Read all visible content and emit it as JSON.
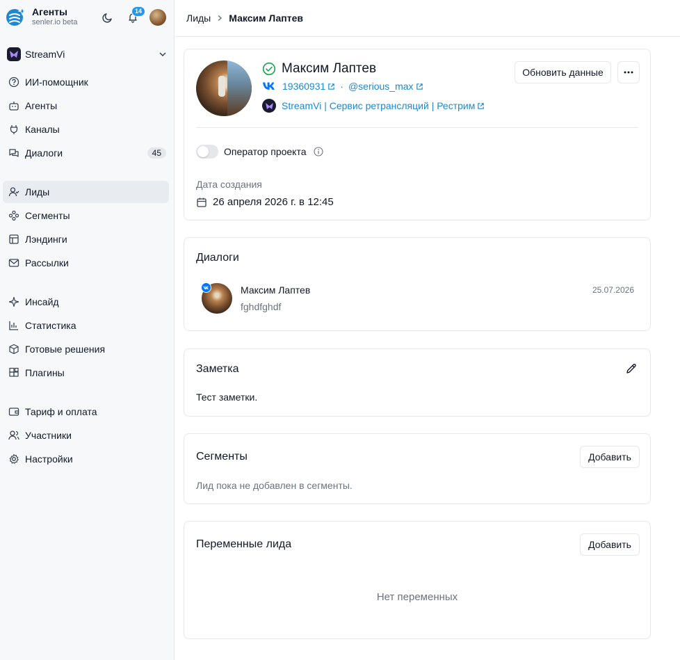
{
  "app": {
    "title": "Агенты",
    "subtitle": "senler.io beta",
    "notifications_count": "14"
  },
  "project": {
    "name": "StreamVi"
  },
  "sidebar": {
    "group1": [
      {
        "label": "ИИ-помощник",
        "icon": "help-circle-icon"
      },
      {
        "label": "Агенты",
        "icon": "bot-icon"
      },
      {
        "label": "Каналы",
        "icon": "plug-icon"
      },
      {
        "label": "Диалоги",
        "icon": "chat-icon",
        "count": "45"
      }
    ],
    "group2": [
      {
        "label": "Лиды",
        "icon": "user-check-icon",
        "active": true
      },
      {
        "label": "Сегменты",
        "icon": "segments-icon"
      },
      {
        "label": "Лэндинги",
        "icon": "layout-icon"
      },
      {
        "label": "Рассылки",
        "icon": "mail-icon"
      }
    ],
    "group3": [
      {
        "label": "Инсайд",
        "icon": "sparkle-icon"
      },
      {
        "label": "Статистика",
        "icon": "bar-chart-icon"
      },
      {
        "label": "Готовые решения",
        "icon": "box-icon"
      },
      {
        "label": "Плагины",
        "icon": "puzzle-icon"
      }
    ],
    "group4": [
      {
        "label": "Тариф и оплата",
        "icon": "wallet-icon"
      },
      {
        "label": "Участники",
        "icon": "users-icon"
      },
      {
        "label": "Настройки",
        "icon": "gear-icon"
      }
    ]
  },
  "breadcrumb": {
    "parent": "Лиды",
    "separator": ">",
    "current": "Максим Лаптев"
  },
  "lead": {
    "name": "Максим Лаптев",
    "vk_id": "19360931",
    "separator": "·",
    "username": "@serious_max",
    "project_link": "StreamVi | Сервис ретрансляций | Рестрим",
    "update_button": "Обновить данные",
    "more_button": "···",
    "operator_label": "Оператор проекта",
    "operator_enabled": false,
    "created_label": "Дата создания",
    "created_value": "26 апреля 2026 г. в 12:45"
  },
  "dialogs": {
    "title": "Диалоги",
    "items": [
      {
        "name": "Максим Лаптев",
        "preview": "fghdfghdf",
        "date": "25.07.2026",
        "channel": "VK"
      }
    ]
  },
  "note": {
    "title": "Заметка",
    "text": "Тест заметки."
  },
  "segments": {
    "title": "Сегменты",
    "add_button": "Добавить",
    "empty": "Лид пока не добавлен в сегменты."
  },
  "variables": {
    "title": "Переменные лида",
    "add_button": "Добавить",
    "empty": "Нет переменных"
  },
  "colors": {
    "accent": "#1e88d3",
    "vk": "#0077ff",
    "check": "#16a34a",
    "sidebar_bg": "#f6f8fa"
  }
}
